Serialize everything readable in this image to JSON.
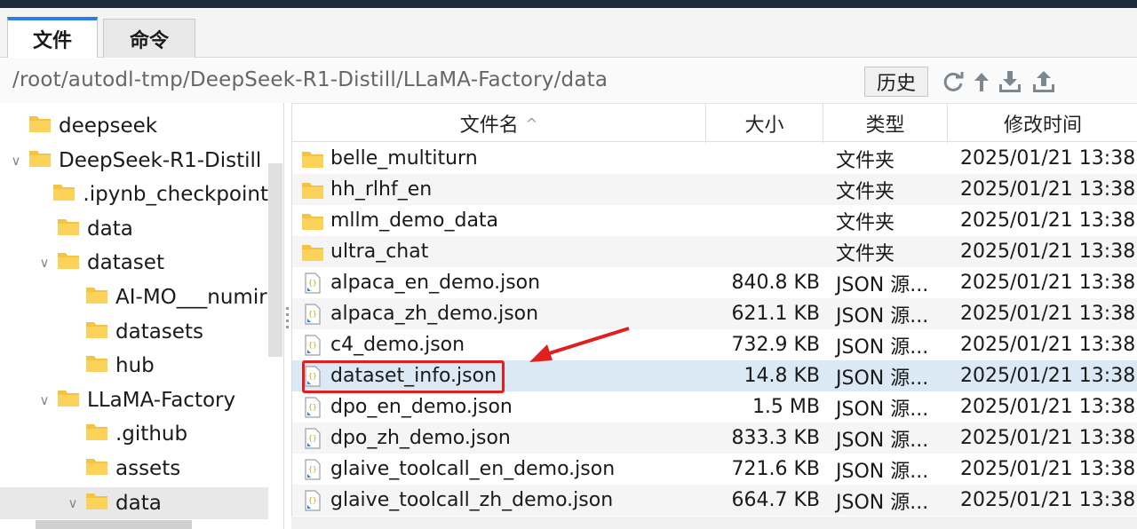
{
  "tabs": {
    "files": "文件",
    "command": "命令"
  },
  "path": {
    "value": "/root/autodl-tmp/DeepSeek-R1-Distill/LLaMA-Factory/data",
    "history_label": "历史"
  },
  "toolbar": [
    "refresh-icon",
    "up-arrow-icon",
    "download-icon",
    "upload-icon"
  ],
  "tree": [
    {
      "label": "deepseek",
      "level": 0,
      "chev": ""
    },
    {
      "label": "DeepSeek-R1-Distill",
      "level": 0,
      "chev": "expanded"
    },
    {
      "label": ".ipynb_checkpoint",
      "level": 1,
      "chev": ""
    },
    {
      "label": "data",
      "level": 1,
      "chev": ""
    },
    {
      "label": "dataset",
      "level": 1,
      "chev": "expanded"
    },
    {
      "label": "AI-MO___numir",
      "level": 2,
      "chev": ""
    },
    {
      "label": "datasets",
      "level": 2,
      "chev": ""
    },
    {
      "label": "hub",
      "level": 2,
      "chev": ""
    },
    {
      "label": "LLaMA-Factory",
      "level": 1,
      "chev": "expanded"
    },
    {
      "label": ".github",
      "level": 2,
      "chev": ""
    },
    {
      "label": "assets",
      "level": 2,
      "chev": ""
    },
    {
      "label": "data",
      "level": 2,
      "chev": "expanded",
      "selected": true
    }
  ],
  "columns": {
    "name": "文件名",
    "size": "大小",
    "type": "类型",
    "modified": "修改时间"
  },
  "files": [
    {
      "name": "belle_multiturn",
      "size": "",
      "type": "文件夹",
      "modified": "2025/01/21 13:38",
      "kind": "folder"
    },
    {
      "name": "hh_rlhf_en",
      "size": "",
      "type": "文件夹",
      "modified": "2025/01/21 13:38",
      "kind": "folder"
    },
    {
      "name": "mllm_demo_data",
      "size": "",
      "type": "文件夹",
      "modified": "2025/01/21 13:38",
      "kind": "folder"
    },
    {
      "name": "ultra_chat",
      "size": "",
      "type": "文件夹",
      "modified": "2025/01/21 13:38",
      "kind": "folder"
    },
    {
      "name": "alpaca_en_demo.json",
      "size": "840.8 KB",
      "type": "JSON 源...",
      "modified": "2025/01/21 13:38",
      "kind": "json"
    },
    {
      "name": "alpaca_zh_demo.json",
      "size": "621.1 KB",
      "type": "JSON 源...",
      "modified": "2025/01/21 13:38",
      "kind": "json"
    },
    {
      "name": "c4_demo.json",
      "size": "732.9 KB",
      "type": "JSON 源...",
      "modified": "2025/01/21 13:38",
      "kind": "json"
    },
    {
      "name": "dataset_info.json",
      "size": "14.8 KB",
      "type": "JSON 源...",
      "modified": "2025/01/21 13:38",
      "kind": "json",
      "highlighted": true
    },
    {
      "name": "dpo_en_demo.json",
      "size": "1.5 MB",
      "type": "JSON 源...",
      "modified": "2025/01/21 13:38",
      "kind": "json"
    },
    {
      "name": "dpo_zh_demo.json",
      "size": "833.3 KB",
      "type": "JSON 源...",
      "modified": "2025/01/21 13:38",
      "kind": "json"
    },
    {
      "name": "glaive_toolcall_en_demo.json",
      "size": "721.6 KB",
      "type": "JSON 源...",
      "modified": "2025/01/21 13:38",
      "kind": "json"
    },
    {
      "name": "glaive_toolcall_zh_demo.json",
      "size": "664.7 KB",
      "type": "JSON 源...",
      "modified": "2025/01/21 13:38",
      "kind": "json"
    }
  ],
  "colors": {
    "accent": "#2b7de9",
    "annotation": "#e02020",
    "folder": "#f5c242",
    "highlight_row": "#dbe9f4"
  }
}
